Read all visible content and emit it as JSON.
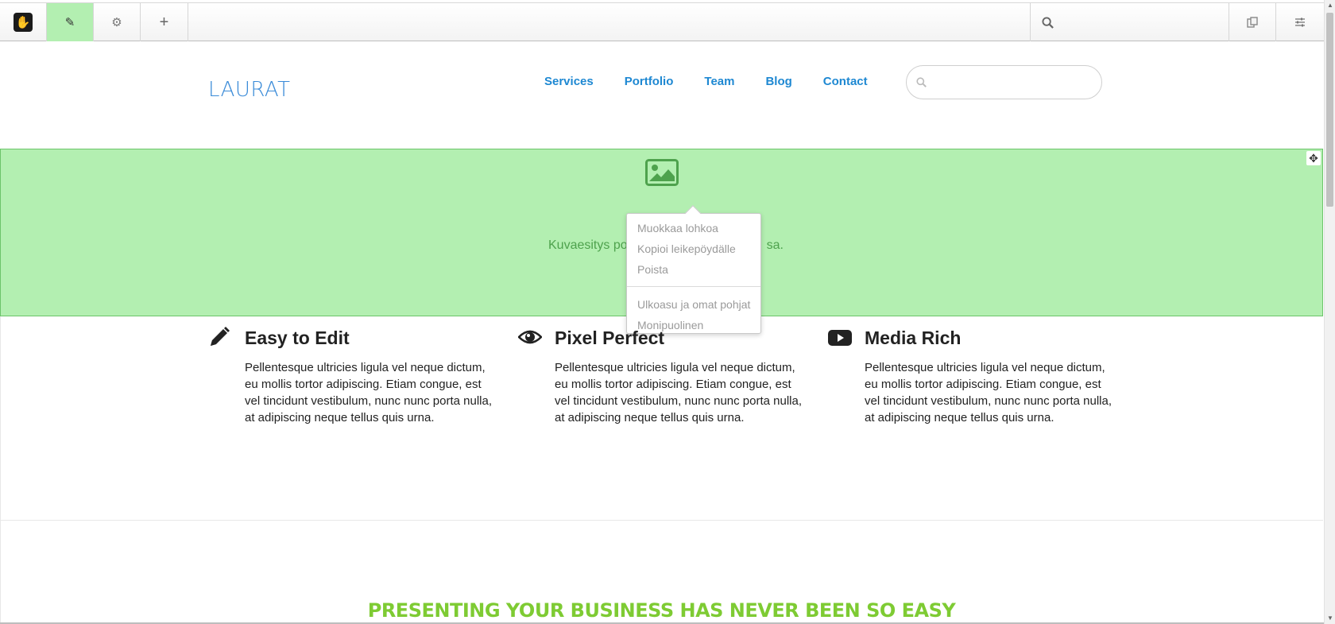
{
  "toolbar": {
    "logo_icon": "concrete5-hand-logo-icon",
    "edit_icon": "pencil-icon",
    "settings_icon": "gear-icon",
    "add_icon": "plus-icon",
    "search_icon": "search-icon",
    "search_placeholder": "",
    "right_icons": [
      "copy-pages-icon",
      "sliders-icon"
    ],
    "active_color": "#b3efb1"
  },
  "site": {
    "logo_text": "LAURAT",
    "nav": [
      "Services",
      "Portfolio",
      "Team",
      "Blog",
      "Contact"
    ],
    "search_placeholder": ""
  },
  "gallery_block": {
    "caption": "Kuvaesitys pois käytöstä muokkaustilassa.",
    "caption_visible_prefix": "Kuvaesitys po",
    "caption_visible_suffix": "sa.",
    "bg_color": "#b3efb1"
  },
  "context_menu": {
    "items_group1": [
      "Muokkaa lohkoa",
      "Kopioi leikepöydälle",
      "Poista"
    ],
    "items_group2": [
      "Ulkoasu ja omat pohjat",
      "Monipuolinen"
    ]
  },
  "features": [
    {
      "icon": "pencil-icon",
      "title": "Easy to Edit",
      "text": "Pellentesque ultricies ligula vel neque dictum, eu mollis tortor adipiscing. Etiam congue, est vel tincidunt vestibulum, nunc nunc porta nulla, at adipiscing neque tellus quis urna."
    },
    {
      "icon": "eye-icon",
      "title": "Pixel Perfect",
      "text": "Pellentesque ultricies ligula vel neque dictum, eu mollis tortor adipiscing. Etiam congue, est vel tincidunt vestibulum, nunc nunc porta nulla, at adipiscing neque tellus quis urna."
    },
    {
      "icon": "youtube-play-icon",
      "title": "Media Rich",
      "text": "Pellentesque ultricies ligula vel neque dictum, eu mollis tortor adipiscing. Etiam congue, est vel tincidunt vestibulum, nunc nunc porta nulla, at adipiscing neque tellus quis urna."
    }
  ],
  "tagline": "PRESENTING YOUR BUSINESS HAS NEVER BEEN SO EASY",
  "colors": {
    "nav_link": "#1e88d2",
    "tagline": "#7ecb33",
    "logo": "#3a8bd8"
  }
}
